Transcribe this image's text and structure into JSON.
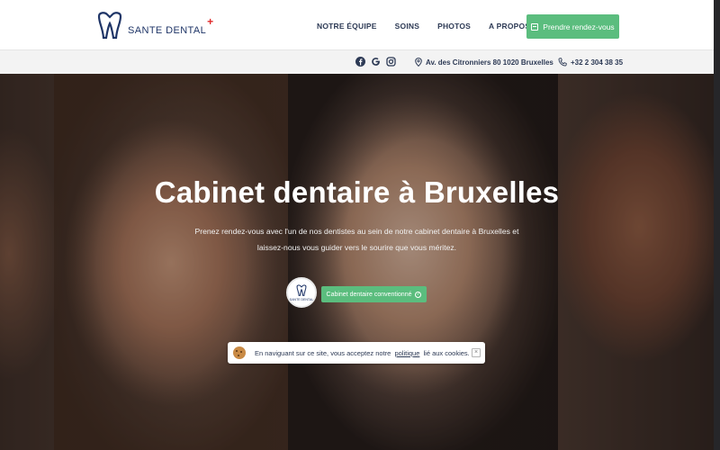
{
  "header": {
    "logo_text": "SANTE DENTAL",
    "logo_cross": "+",
    "nav": [
      "NOTRE ÉQUIPE",
      "SOINS",
      "PHOTOS",
      "A PROPOS"
    ],
    "cta_label": "Prendre rendez-vous"
  },
  "infobar": {
    "social_icons": [
      "facebook-icon",
      "google-icon",
      "instagram-icon"
    ],
    "address": "Av. des Citronniers 80 1020 Bruxelles",
    "phone": "+32 2 304 38 35"
  },
  "hero": {
    "title": "Cabinet dentaire à Bruxelles",
    "subtitle": "Prenez rendez-vous avec l'un de nos dentistes au sein de notre cabinet dentaire à Bruxelles et laissez-nous vous guider vers le sourire que vous méritez.",
    "badge_logo_text": "SANTE DENTAL",
    "badge_button": "Cabinet dentaire conventionné"
  },
  "cookie": {
    "text_before": "En naviguant sur ce site, vous acceptez notre",
    "link": "politique",
    "text_after": "lié aux cookies.",
    "close": "×"
  },
  "colors": {
    "accent_green": "#5bbd7e",
    "navy": "#1f3567",
    "logo_cross_red": "#e02a2a"
  }
}
